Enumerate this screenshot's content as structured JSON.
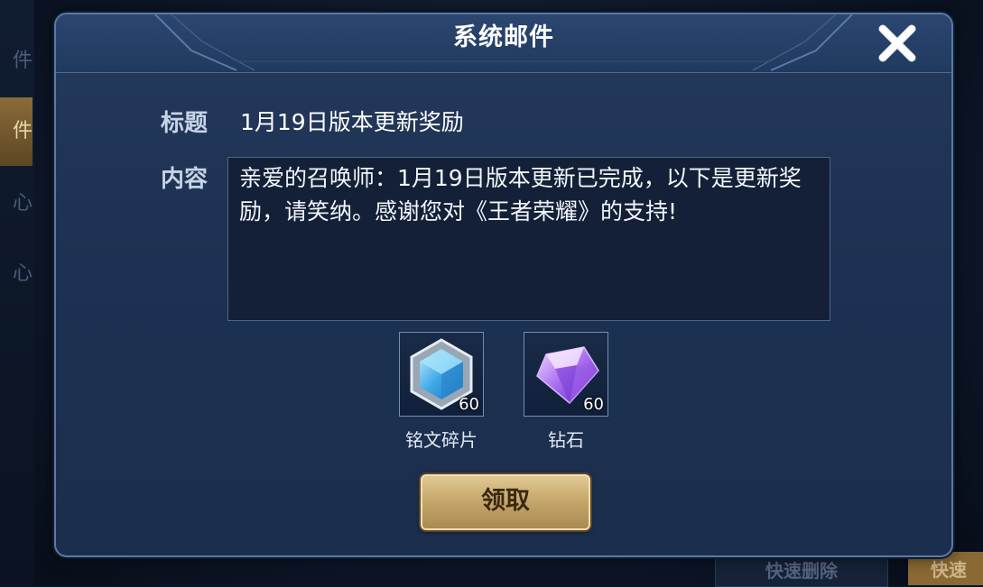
{
  "background": {
    "left_tabs": [
      "件",
      "件",
      "心",
      "心"
    ],
    "bottom_buttons": {
      "quick_delete": "快速删除",
      "quick_claim": "快速"
    }
  },
  "dialog": {
    "title": "系统邮件",
    "close_icon": "close-icon",
    "title_label": "标题",
    "title_value": "1月19日版本更新奖励",
    "content_label": "内容",
    "content_text": "亲爱的召唤师：1月19日版本更新已完成，以下是更新奖励，请笑纳。感谢您对《王者荣耀》的支持!",
    "rewards": [
      {
        "name": "铭文碎片",
        "count": "60",
        "icon": "inscription-shard-icon"
      },
      {
        "name": "钻石",
        "count": "60",
        "icon": "diamond-icon"
      }
    ],
    "claim_label": "领取"
  },
  "colors": {
    "dialog_bg": "#1d3152",
    "border": "#5b7aa3",
    "claim_button": "#c7a86c",
    "text": "#ffffff"
  }
}
